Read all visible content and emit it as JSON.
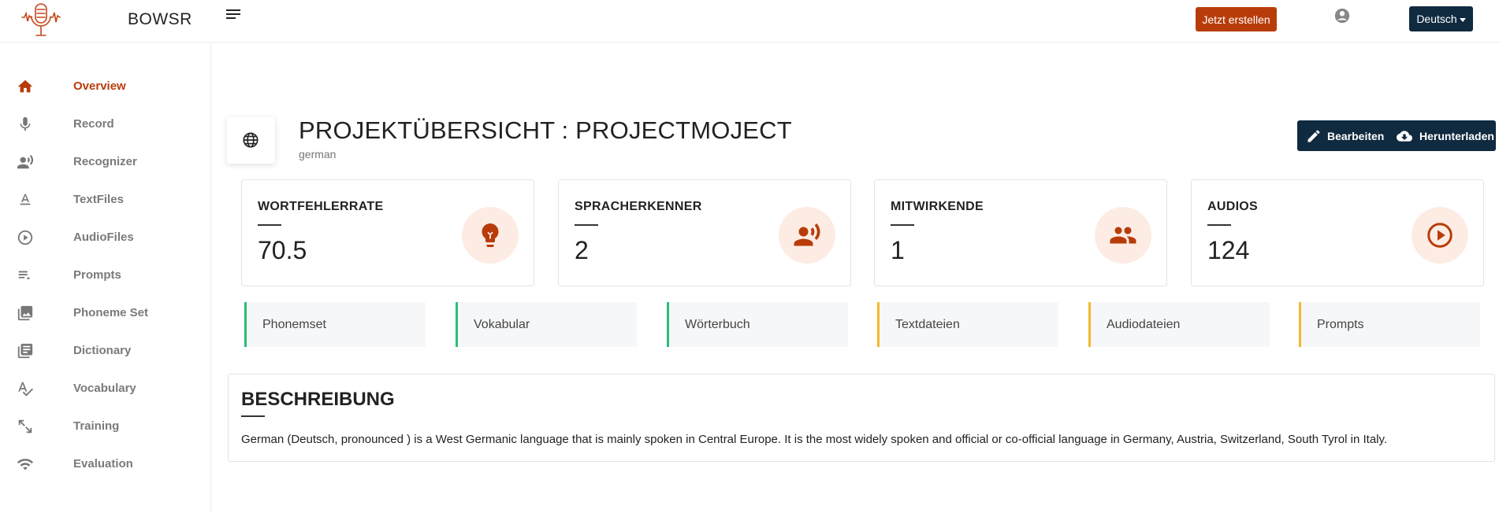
{
  "header": {
    "brand": "BOWSR",
    "create_label": "Jetzt erstellen",
    "language_label": "Deutsch",
    "accent_color": "#b83c0a",
    "dark_color": "#102a40"
  },
  "sidebar": {
    "items": [
      {
        "label": "Overview",
        "icon": "home-icon",
        "active": true
      },
      {
        "label": "Record",
        "icon": "microphone-icon"
      },
      {
        "label": "Recognizer",
        "icon": "voice-recognizer-icon"
      },
      {
        "label": "TextFiles",
        "icon": "text-format-icon"
      },
      {
        "label": "AudioFiles",
        "icon": "play-circle-icon"
      },
      {
        "label": "Prompts",
        "icon": "playlist-icon"
      },
      {
        "label": "Phoneme Set",
        "icon": "image-library-icon"
      },
      {
        "label": "Dictionary",
        "icon": "library-books-icon"
      },
      {
        "label": "Vocabulary",
        "icon": "spellcheck-icon"
      },
      {
        "label": "Training",
        "icon": "expand-arrows-icon"
      },
      {
        "label": "Evaluation",
        "icon": "wifi-signal-icon"
      }
    ]
  },
  "project": {
    "title": "PROJEKTÜBERSICHT : PROJECTMOJECT",
    "language": "german",
    "edit_label": "Bearbeiten",
    "download_label": "Herunterladen"
  },
  "stats": [
    {
      "label": "WORTFEHLERRATE",
      "value": "70.5",
      "icon": "lightbulb-icon"
    },
    {
      "label": "SPRACHERKENNER",
      "value": "2",
      "icon": "voice-recognizer-icon"
    },
    {
      "label": "MITWIRKENDE",
      "value": "1",
      "icon": "people-icon"
    },
    {
      "label": "AUDIOS",
      "value": "124",
      "icon": "play-circle-icon"
    }
  ],
  "links": [
    {
      "label": "Phonemset",
      "status_color": "#2bbf74"
    },
    {
      "label": "Vokabular",
      "status_color": "#2bbf74"
    },
    {
      "label": "Wörterbuch",
      "status_color": "#2bbf74"
    },
    {
      "label": "Textdateien",
      "status_color": "#f5b92e"
    },
    {
      "label": "Audiodateien",
      "status_color": "#f5b92e"
    },
    {
      "label": "Prompts",
      "status_color": "#f5b92e"
    }
  ],
  "description": {
    "title": "BESCHREIBUNG",
    "text": "German (Deutsch, pronounced ) is a West Germanic language that is mainly spoken in Central Europe. It is the most widely spoken and official or co-official language in Germany, Austria, Switzerland, South Tyrol in Italy."
  }
}
